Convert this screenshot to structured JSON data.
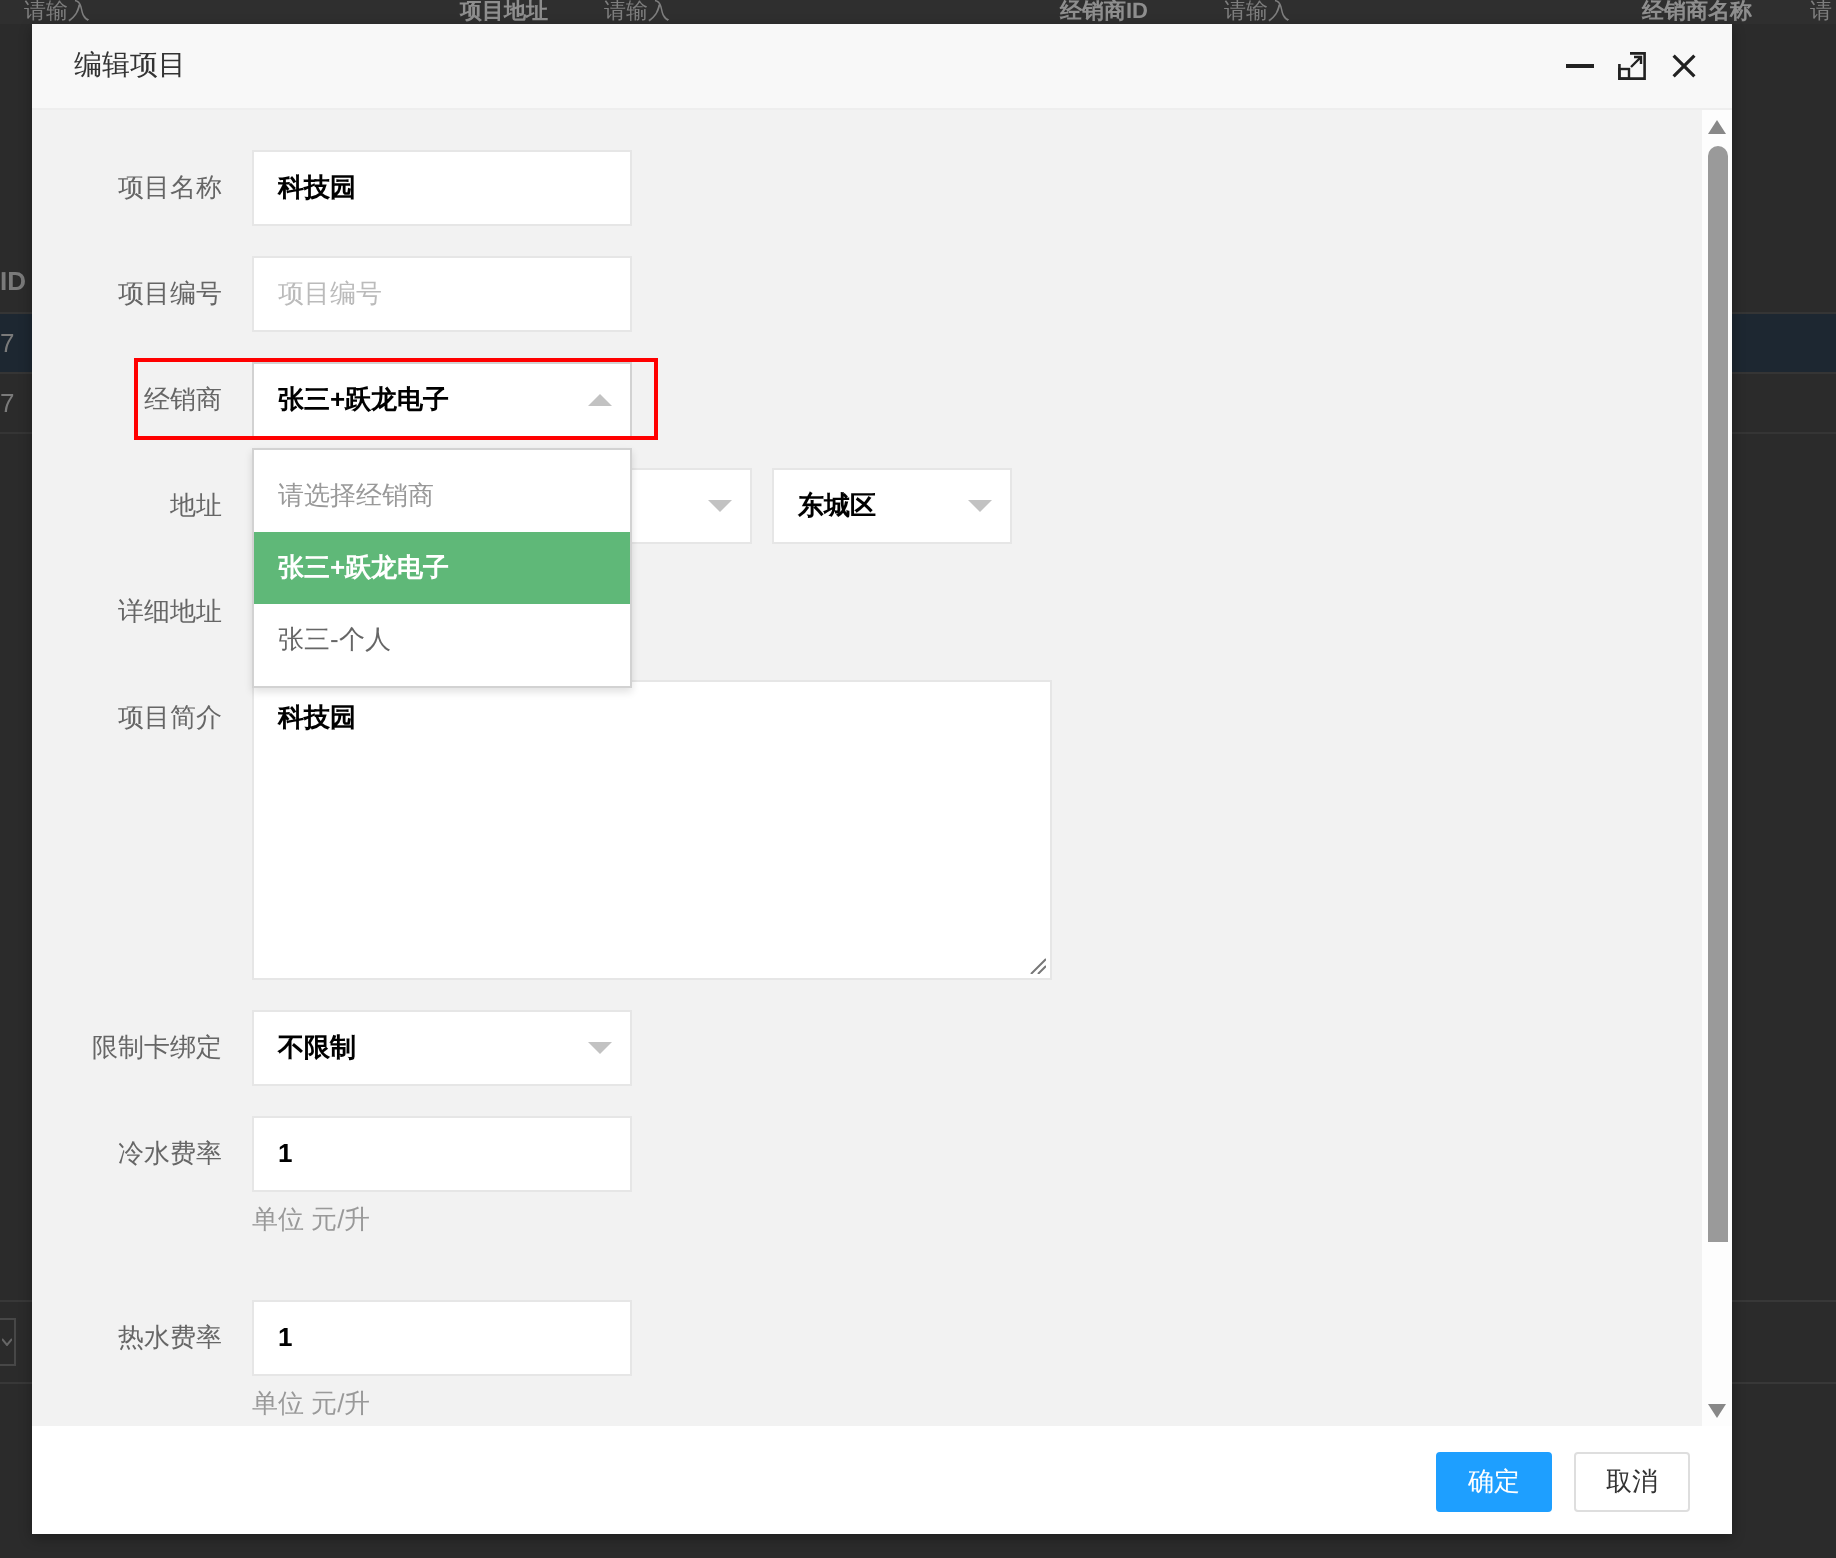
{
  "background_page": {
    "filters": [
      {
        "kind": "input",
        "placeholder": "请输入"
      },
      {
        "kind": "label",
        "text": "项目地址"
      },
      {
        "kind": "input",
        "placeholder": "请输入"
      },
      {
        "kind": "label",
        "text": "经销商ID"
      },
      {
        "kind": "input",
        "placeholder": "请输入"
      },
      {
        "kind": "label",
        "text": "经销商名称"
      },
      {
        "kind": "input",
        "placeholder": "请"
      }
    ],
    "table": {
      "columns": [
        "ID"
      ],
      "rows": [
        {
          "cells": [
            "7"
          ],
          "selected": true
        },
        {
          "cells": [
            "7"
          ],
          "selected": false
        }
      ]
    }
  },
  "dialog": {
    "title": "编辑项目",
    "fields": [
      {
        "kind": "input",
        "label": "项目名称",
        "value": "科技园"
      },
      {
        "kind": "input",
        "label": "项目编号",
        "placeholder": "项目编号"
      },
      {
        "kind": "select",
        "label": "经销商",
        "value": "张三+跃龙电子",
        "expanded": true,
        "highlighted": true,
        "options": [
          {
            "kind": "placeholder",
            "label": "请选择经销商",
            "selected": false
          },
          {
            "kind": "option",
            "label": "张三+跃龙电子",
            "selected": true
          },
          {
            "kind": "option",
            "label": "张三-个人",
            "selected": false
          }
        ]
      },
      {
        "kind": "address",
        "label": "地址",
        "selects": [
          {
            "expanded": false
          },
          {
            "value": "东城区",
            "expanded": false
          }
        ]
      },
      {
        "kind": "covered",
        "label": "详细地址"
      },
      {
        "kind": "textarea",
        "label": "项目简介",
        "value": "科技园"
      },
      {
        "kind": "select",
        "label": "限制卡绑定",
        "value": "不限制",
        "expanded": false
      },
      {
        "kind": "input",
        "label": "冷水费率",
        "value": "1",
        "hint": "单位 元/升"
      },
      {
        "kind": "input",
        "label": "热水费率",
        "value": "1",
        "hint": "单位 元/升"
      }
    ],
    "buttons": [
      {
        "kind": "primary",
        "label": "确定"
      },
      {
        "kind": "secondary",
        "label": "取消"
      }
    ]
  }
}
